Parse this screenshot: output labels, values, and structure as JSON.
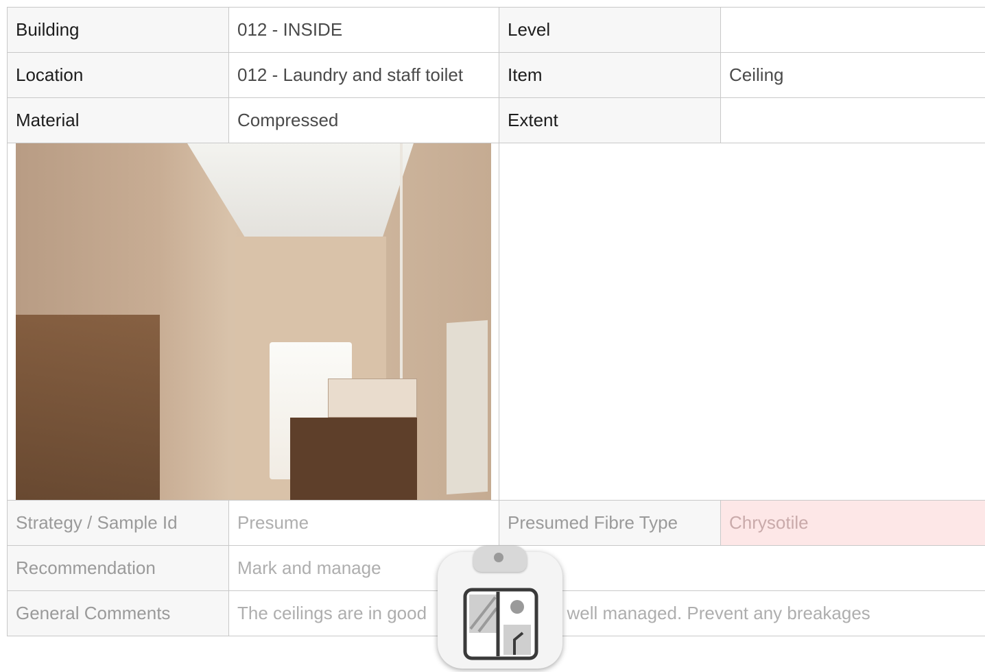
{
  "rows_top": [
    {
      "label1": "Building",
      "value1": "012 - INSIDE",
      "label2": "Level",
      "value2": ""
    },
    {
      "label1": "Location",
      "value1": "012 - Laundry and staff toilet",
      "label2": "Item",
      "value2": "Ceiling"
    },
    {
      "label1": "Material",
      "value1": "Compressed",
      "label2": "Extent",
      "value2": ""
    }
  ],
  "photo": {
    "alt": "Laundry room photo"
  },
  "rows_bottom": {
    "strategy": {
      "label": "Strategy / Sample Id",
      "value": "Presume",
      "label2": "Presumed Fibre Type",
      "value2": "Chrysotile"
    },
    "recommendation": {
      "label": "Recommendation",
      "value": "Mark and manage"
    },
    "comments": {
      "label": "General Comments",
      "value": "The ceilings are in good",
      "value_tail": "is well managed. Prevent any breakages"
    }
  },
  "colors": {
    "fibre_highlight": "#fde7e7",
    "border": "#c8c8c8",
    "label_bg": "#f7f7f7"
  },
  "overlay": {
    "icon": "clipboard-icon"
  }
}
